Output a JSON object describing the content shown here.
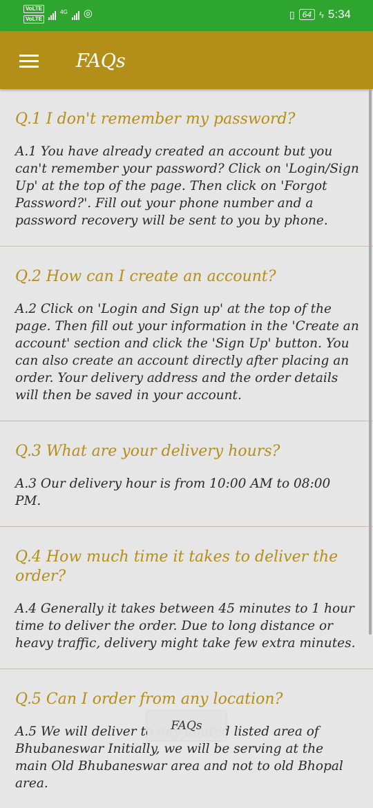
{
  "status_bar": {
    "volte1": "VoLTE",
    "volte2": "VoLTE",
    "network": "4G",
    "battery": "64",
    "time": "5:34"
  },
  "app_bar": {
    "title": "FAQs"
  },
  "faqs": [
    {
      "question": "Q.1 I don't remember my password?",
      "answer": "A.1 You have already created an account but you can't remember your password? Click on 'Login/Sign Up' at the top of the page. Then click on 'Forgot Password?'. Fill out your phone number and a password recovery will be sent to you by phone."
    },
    {
      "question": "Q.2 How can I create an account?",
      "answer": "A.2 Click on 'Login and Sign up' at the top of the page. Then fill out your information in the 'Create an account' section and click the 'Sign Up' button. You can also create an account directly after placing an order. Your delivery address and the order details will then be saved in your account."
    },
    {
      "question": "Q.3 What are your delivery hours?",
      "answer": "A.3 Our delivery hour is from 10:00 AM to 08:00 PM."
    },
    {
      "question": "Q.4 How much time it takes to deliver the order?",
      "answer": "A.4 Generally it takes between 45 minutes to 1 hour time to deliver the order. Due to long distance or heavy traffic, delivery might take few extra minutes."
    },
    {
      "question": "Q.5 Can I order from any location?",
      "answer": "A.5 We will deliver to any limited listed area of Bhubaneswar Initially, we will be serving at the main Old Bhubaneswar area and not to old Bhopal area."
    }
  ],
  "toast": {
    "text": "FAQs"
  }
}
